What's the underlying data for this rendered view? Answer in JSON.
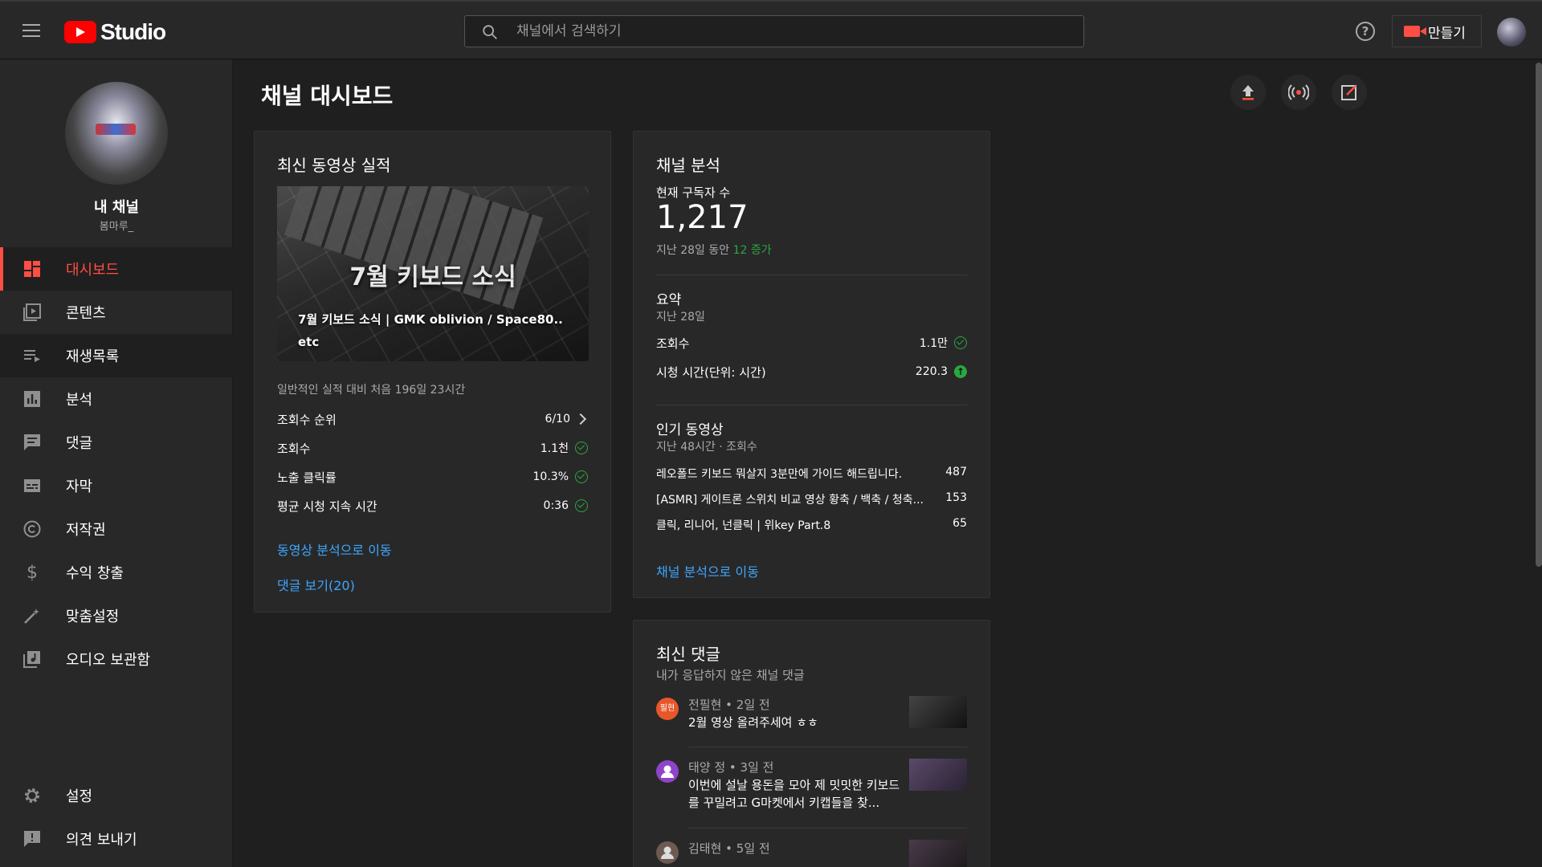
{
  "header": {
    "logo_text": "Studio",
    "search_placeholder": "채널에서 검색하기",
    "create_label": "만들기"
  },
  "sidebar": {
    "channel_name": "내 채널",
    "channel_handle": "봄마루_",
    "items": [
      {
        "label": "대시보드",
        "icon": "dashboard-icon",
        "active": true
      },
      {
        "label": "콘텐츠",
        "icon": "content-icon"
      },
      {
        "label": "재생목록",
        "icon": "playlist-icon"
      },
      {
        "label": "분석",
        "icon": "analytics-icon"
      },
      {
        "label": "댓글",
        "icon": "comments-icon"
      },
      {
        "label": "자막",
        "icon": "subtitles-icon"
      },
      {
        "label": "저작권",
        "icon": "copyright-icon"
      },
      {
        "label": "수익 창출",
        "icon": "monetization-icon"
      },
      {
        "label": "맞춤설정",
        "icon": "customization-icon"
      },
      {
        "label": "오디오 보관함",
        "icon": "audio-library-icon"
      }
    ],
    "bottom_items": [
      {
        "label": "설정",
        "icon": "settings-icon"
      },
      {
        "label": "의견 보내기",
        "icon": "feedback-icon"
      }
    ]
  },
  "page": {
    "title": "채널 대시보드"
  },
  "latest_video": {
    "card_title": "최신 동영상 실적",
    "thumb_title": "7월 키보드 소식",
    "thumb_caption": "7월 키보드 소식 | GMK oblivion / Space80.. etc",
    "period_note": "일반적인 실적 대비 처음 196일 23시간",
    "stats": [
      {
        "label": "조회수 순위",
        "value": "6/10",
        "indicator": "chevron"
      },
      {
        "label": "조회수",
        "value": "1.1천",
        "indicator": "check"
      },
      {
        "label": "노출 클릭률",
        "value": "10.3%",
        "indicator": "check"
      },
      {
        "label": "평균 시청 지속 시간",
        "value": "0:36",
        "indicator": "check"
      }
    ],
    "link_analytics": "동영상 분석으로 이동",
    "link_comments": "댓글 보기(20)"
  },
  "channel_analytics": {
    "card_title": "채널 분석",
    "subs_label": "현재 구독자 수",
    "subs_value": "1,217",
    "subs_change_prefix": "지난 28일 동안",
    "subs_change": "12 증가",
    "summary_title": "요약",
    "summary_period": "지난 28일",
    "summary": [
      {
        "label": "조회수",
        "value": "1.1만",
        "indicator": "check"
      },
      {
        "label": "시청 시간(단위: 시간)",
        "value": "220.3",
        "indicator": "up"
      }
    ],
    "top_title": "인기 동영상",
    "top_period": "지난 48시간 · 조회수",
    "top_videos": [
      {
        "title": "레오폴드 키보드 뭐살지 3분만에 가이드 해드립니다.",
        "views": "487"
      },
      {
        "title": "[ASMR] 게이트론 스위치 비교 영상 황축 / 백축 / 청축...",
        "views": "153"
      },
      {
        "title": "클릭, 리니어, 넌클릭 | 위key Part.8",
        "views": "65"
      }
    ],
    "link": "채널 분석으로 이동"
  },
  "latest_comments": {
    "card_title": "최신 댓글",
    "subtitle": "내가 응답하지 않은 채널 댓글",
    "comments": [
      {
        "avatar_text": "필현",
        "avatar_color": "#e8572a",
        "meta": "전필현 • 2일 전",
        "text": "2월 영상 올려주세여 ㅎㅎ"
      },
      {
        "avatar_text": "",
        "avatar_color": "#8e44c9",
        "meta": "태양 정 • 3일 전",
        "text": "이번에 설날 용돈을 모아 제 밋밋한 키보드를 꾸밀려고 G마켓에서 키캡들을 찾..."
      },
      {
        "avatar_text": "",
        "avatar_color": "#6d5a52",
        "meta": "김태현 • 5일 전",
        "text": ""
      }
    ]
  },
  "colors": {
    "accent": "#ff4e45",
    "link": "#3ea6ff",
    "success": "#2ba640",
    "background": "#1f1f1f",
    "surface": "#282828"
  }
}
